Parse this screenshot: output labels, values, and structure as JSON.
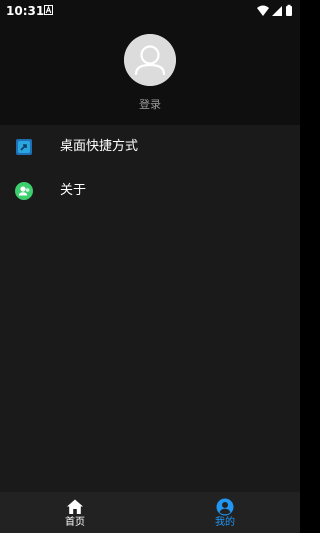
{
  "status_bar": {
    "time": "10:31",
    "icons": [
      "notification-icon",
      "wifi-icon",
      "signal-icon",
      "battery-icon"
    ]
  },
  "profile": {
    "avatar_icon": "user-avatar-icon",
    "login_label": "登录"
  },
  "menu": {
    "items": [
      {
        "label": "桌面快捷方式",
        "icon": "shortcut-icon",
        "icon_color": "#2aa5e0"
      },
      {
        "label": "关于",
        "icon": "about-user-icon",
        "icon_color": "#3ccf6e"
      }
    ]
  },
  "bottom_nav": {
    "items": [
      {
        "label": "首页",
        "icon": "home-icon",
        "active": false
      },
      {
        "label": "我的",
        "icon": "profile-icon",
        "active": true
      }
    ],
    "active_color": "#2196f3"
  }
}
